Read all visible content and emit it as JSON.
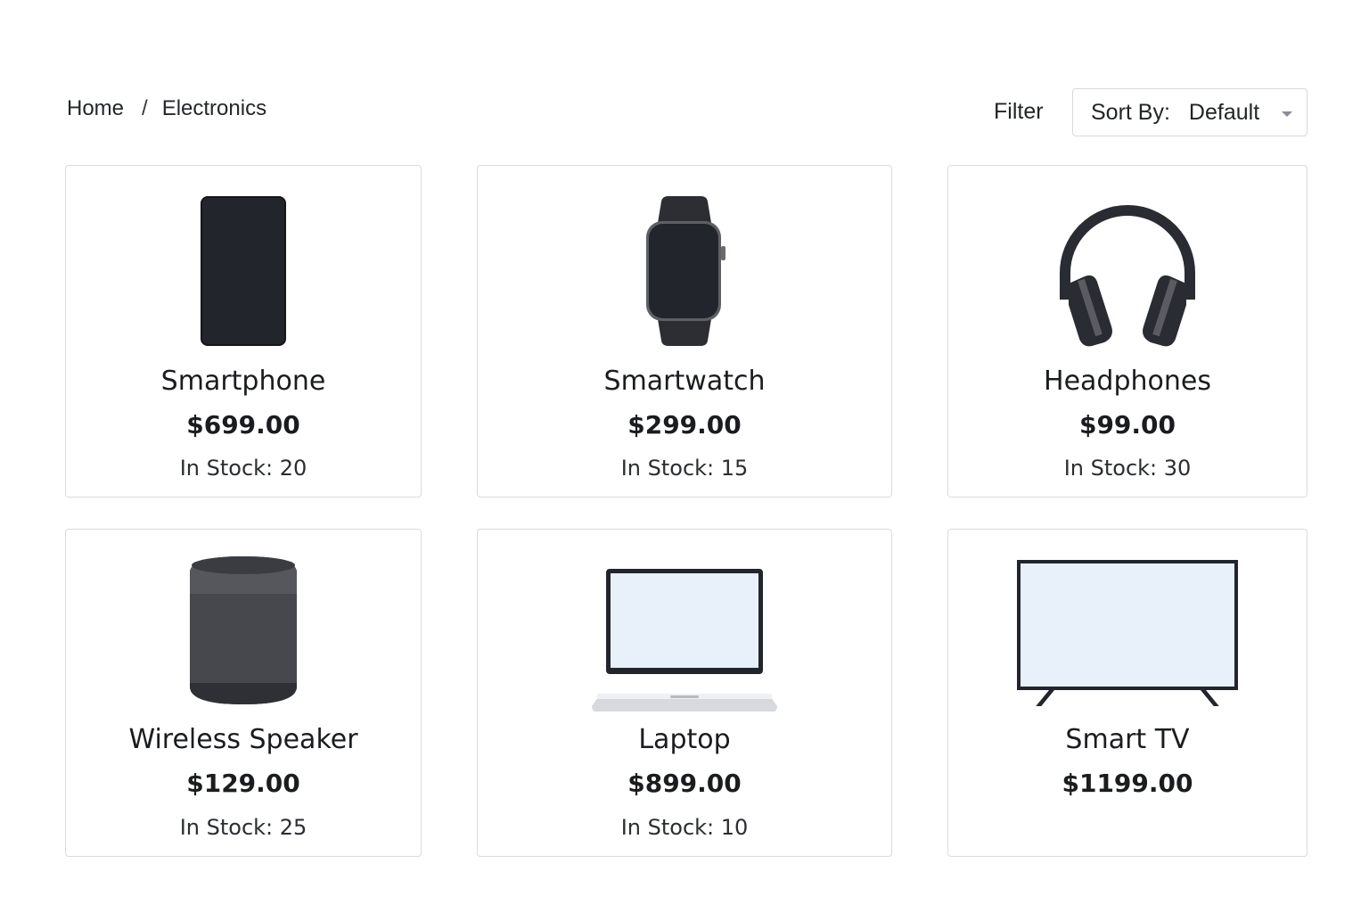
{
  "breadcrumb": {
    "home": "Home",
    "separator": "/",
    "current": "Electronics"
  },
  "toolbar": {
    "filter_label": "Filter",
    "sort_prefix": "Sort By:",
    "sort_value": "Default"
  },
  "products": [
    {
      "name": "Smartphone",
      "price": "$699.00",
      "stock": "In Stock: 20",
      "icon": "smartphone-icon"
    },
    {
      "name": "Smartwatch",
      "price": "$299.00",
      "stock": "In Stock: 15",
      "icon": "smartwatch-icon"
    },
    {
      "name": "Headphones",
      "price": "$99.00",
      "stock": "In Stock: 30",
      "icon": "headphones-icon"
    },
    {
      "name": "Wireless Speaker",
      "price": "$129.00",
      "stock": "In Stock: 25",
      "icon": "speaker-icon"
    },
    {
      "name": "Laptop",
      "price": "$899.00",
      "stock": "In Stock: 10",
      "icon": "laptop-icon"
    },
    {
      "name": "Smart TV",
      "price": "$1199.00",
      "icon": "tv-icon"
    }
  ],
  "colors": {
    "device_dark": "#22252c",
    "screen_light": "#e8f1fa",
    "border": "#d9dbdf"
  }
}
